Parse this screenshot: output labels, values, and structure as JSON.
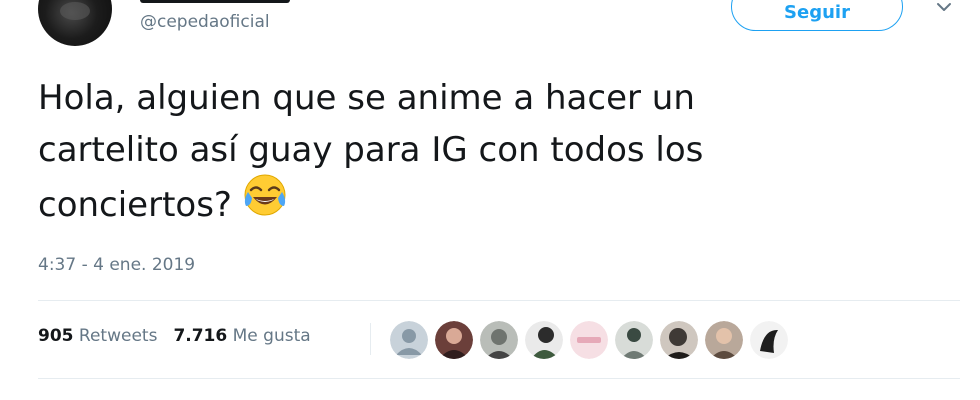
{
  "header": {
    "handle": "@cepedaoficial",
    "follow_label": "Seguir"
  },
  "tweet": {
    "lines": [
      "Hola, alguien que se anime a hacer un",
      "cartelito así guay para IG con todos los",
      "conciertos?"
    ],
    "emoji": "face-with-tears-of-joy",
    "timestamp": "4:37 - 4 ene. 2019"
  },
  "stats": {
    "retweets_count": "905",
    "retweets_label": "Retweets",
    "likes_count": "7.716",
    "likes_label": "Me gusta"
  },
  "likers": {
    "count_shown": 9,
    "colors": [
      "#8899a6",
      "#6b3f3a",
      "#8a8f8a",
      "#4e5a4a",
      "#f1d6dc",
      "#6f7a74",
      "#3f3a36",
      "#8c7a6c",
      "#1e1e1e"
    ]
  },
  "colors": {
    "accent": "#1da1f2",
    "text": "#14171a",
    "muted": "#657786",
    "divider": "#e6ecf0"
  }
}
